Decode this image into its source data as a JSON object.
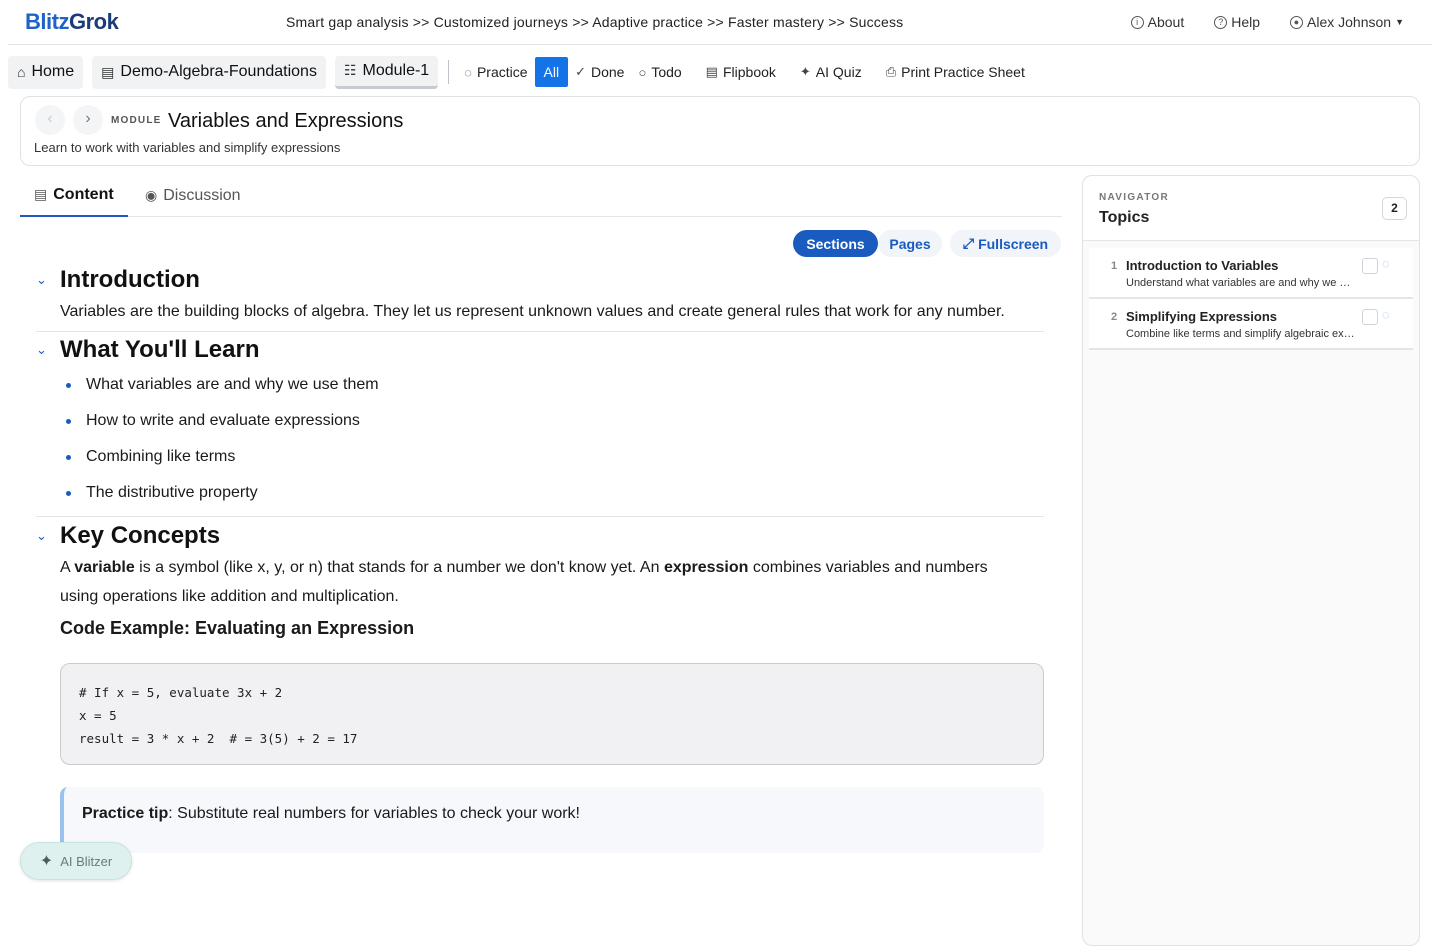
{
  "brand": {
    "part1": "Blitz",
    "part2": "Grok"
  },
  "tagline": "Smart gap analysis >> Customized journeys >> Adaptive practice >> Faster mastery >> Success",
  "toplinks": {
    "about": "About",
    "help": "Help",
    "user": "Alex Johnson"
  },
  "breadcrumbs": [
    {
      "label": "Home",
      "icon": "home-icon"
    },
    {
      "label": "Demo-Algebra-Foundations",
      "icon": "document-icon"
    },
    {
      "label": "Module-1",
      "icon": "book-icon"
    }
  ],
  "toolbar": {
    "practice": "Practice",
    "all": "All",
    "done": "Done",
    "todo": "Todo",
    "flipbook": "Flipbook",
    "ai_quiz": "AI Quiz",
    "print": "Print Practice Sheet"
  },
  "module": {
    "label": "MODULE",
    "title": "Variables and Expressions",
    "subtitle": "Learn to work with variables and simplify expressions"
  },
  "tabs": {
    "content": "Content",
    "discussion": "Discussion"
  },
  "view_switch": {
    "sections": "Sections",
    "pages": "Pages",
    "fullscreen": "Fullscreen"
  },
  "sections": {
    "intro": {
      "title": "Introduction",
      "text": "Variables are the building blocks of algebra. They let us represent unknown values and create general rules that work for any number."
    },
    "learn": {
      "title": "What You'll Learn",
      "items": [
        "What variables are and why we use them",
        "How to write and evaluate expressions",
        "Combining like terms",
        "The distributive property"
      ]
    },
    "concepts": {
      "title": "Key Concepts",
      "p_a": "A ",
      "p_variable": "variable",
      "p_b": " is a symbol (like x, y, or n) that stands for a number we don't know yet. An ",
      "p_expression": "expression",
      "p_c": " combines variables and numbers",
      "p_d": "using operations like addition and multiplication.",
      "code_title": "Code Example: Evaluating an Expression",
      "code": [
        "# If x = 5, evaluate 3x + 2",
        "x = 5",
        "result = 3 * x + 2  # = 3(5) + 2 = 17"
      ],
      "tip_bold": "Practice tip",
      "tip_text": ": Substitute real numbers for variables to check your work!"
    }
  },
  "ai_button": "AI Blitzer",
  "navigator": {
    "label": "NAVIGATOR",
    "title": "Topics",
    "count": "2",
    "topics": [
      {
        "num": "1",
        "title": "Introduction to Variables",
        "desc": "Understand what variables are and why we use them"
      },
      {
        "num": "2",
        "title": "Simplifying Expressions",
        "desc": "Combine like terms and simplify algebraic expressions"
      }
    ]
  }
}
